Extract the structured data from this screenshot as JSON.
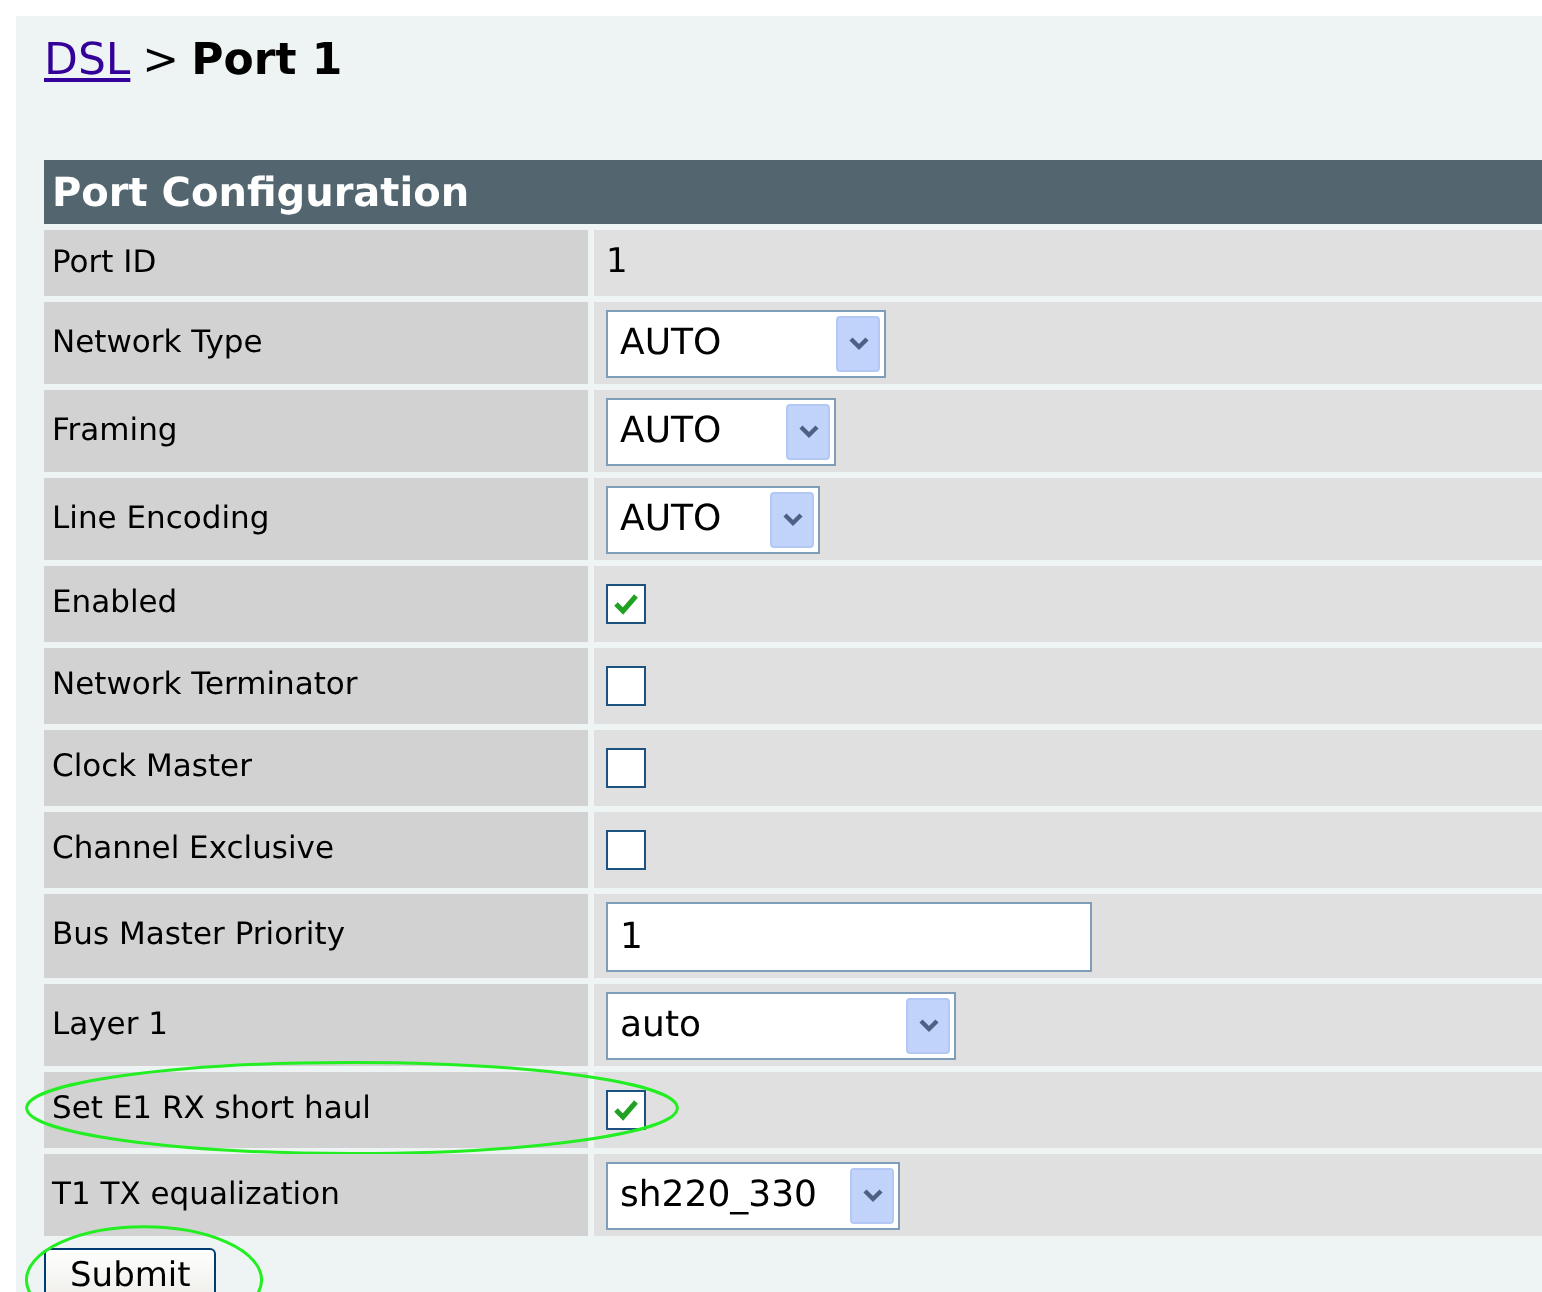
{
  "breadcrumb": {
    "link": "DSL",
    "separator": ">",
    "current": "Port 1"
  },
  "section_title": "Port Configuration",
  "rows": [
    {
      "label": "Port ID",
      "kind": "text",
      "value": "1",
      "highlighted": false
    },
    {
      "label": "Network Type",
      "kind": "select",
      "value": "AUTO",
      "highlighted": false
    },
    {
      "label": "Framing",
      "kind": "select",
      "value": "AUTO",
      "highlighted": false
    },
    {
      "label": "Line Encoding",
      "kind": "select",
      "value": "AUTO",
      "highlighted": false
    },
    {
      "label": "Enabled",
      "kind": "checkbox",
      "checked": true,
      "highlighted": false
    },
    {
      "label": "Network Terminator",
      "kind": "checkbox",
      "checked": false,
      "highlighted": false
    },
    {
      "label": "Clock Master",
      "kind": "checkbox",
      "checked": false,
      "highlighted": false
    },
    {
      "label": "Channel Exclusive",
      "kind": "checkbox",
      "checked": false,
      "highlighted": false
    },
    {
      "label": "Bus Master Priority",
      "kind": "input",
      "value": "1",
      "highlighted": false
    },
    {
      "label": "Layer 1",
      "kind": "select",
      "value": "auto",
      "highlighted": false
    },
    {
      "label": "Set E1 RX short haul",
      "kind": "checkbox",
      "checked": true,
      "highlighted": true
    },
    {
      "label": "T1 TX equalization",
      "kind": "select",
      "value": "sh220_330",
      "highlighted": false
    }
  ],
  "submit": {
    "label": "Submit",
    "highlighted": true
  }
}
